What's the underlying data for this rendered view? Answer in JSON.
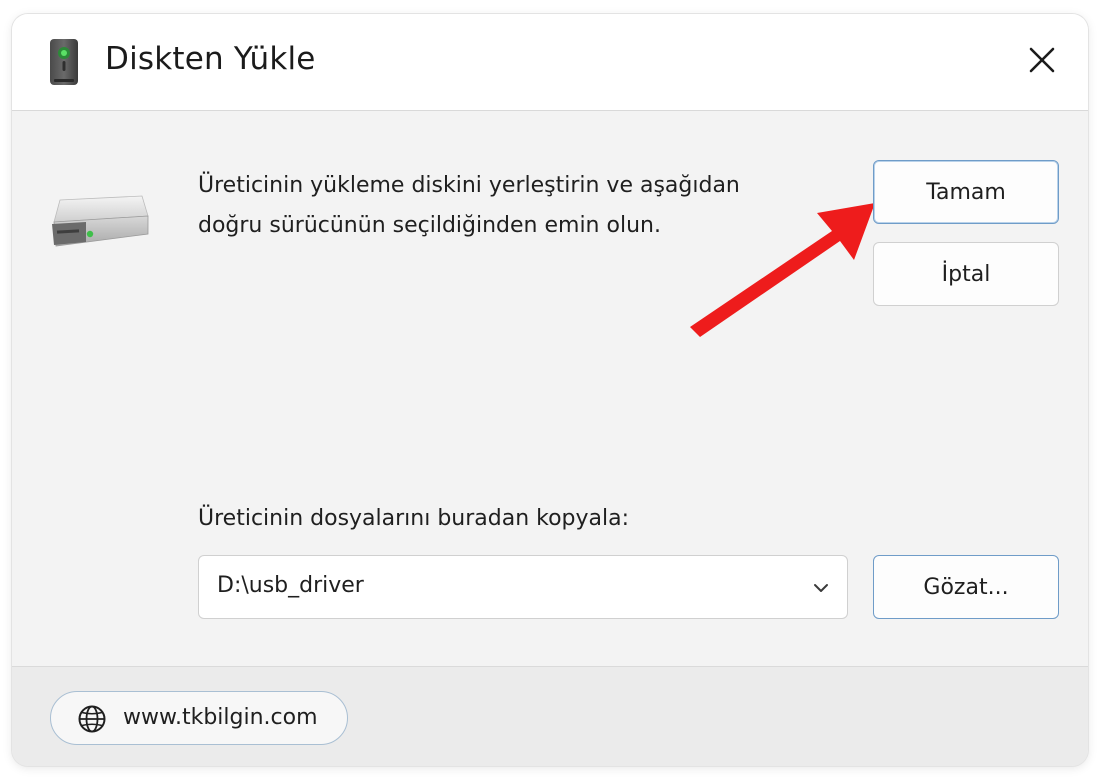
{
  "dialog": {
    "title": "Diskten Yükle",
    "title_icon": "usb-drive-icon",
    "close_icon": "close-icon",
    "message_line1": "Üreticinin yükleme diskini yerleştirin ve aşağıdan",
    "message_line2": "doğru sürücünün seçildiğinden emin olun.",
    "drive_icon": "hard-drive-icon",
    "ok_label": "Tamam",
    "cancel_label": "İptal",
    "copy_label": "Üreticinin dosyalarını buradan kopyala:",
    "path_value": "D:\\usb_driver",
    "browse_label": "Gözat...",
    "annotation": "red-arrow-pointing-to-ok-button"
  },
  "footer": {
    "link_icon": "globe-icon",
    "link_text": "www.tkbilgin.com"
  },
  "colors": {
    "dialog_bg": "#f3f3f3",
    "titlebar_bg": "#ffffff",
    "accent_border": "#6f9cc8",
    "arrow": "#ee1c1c",
    "drive_led": "#3fbf4a"
  }
}
